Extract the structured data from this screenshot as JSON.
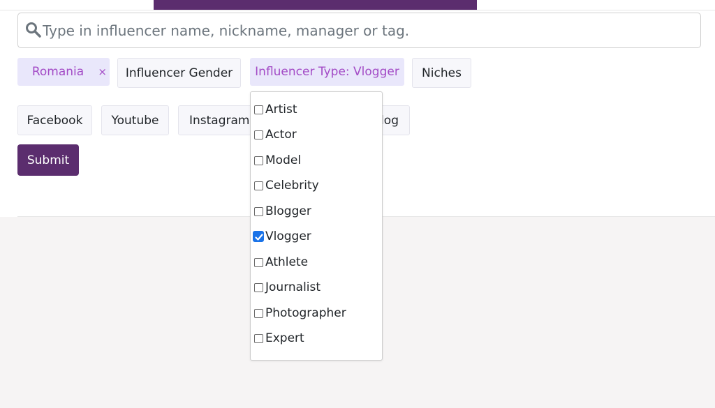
{
  "search": {
    "placeholder": "Type in influencer name, nickname, manager or tag.",
    "value": ""
  },
  "filters": {
    "country": {
      "label": "Romania",
      "remove_symbol": "×"
    },
    "gender": {
      "label": "Influencer Gender"
    },
    "type": {
      "label": "Influencer Type: Vlogger"
    },
    "niches": {
      "label": "Niches"
    }
  },
  "platforms": [
    {
      "label": "Facebook"
    },
    {
      "label": "Youtube"
    },
    {
      "label": "Instagram"
    },
    {
      "label": "log"
    }
  ],
  "submit_label": "Submit",
  "type_dropdown": {
    "options": [
      {
        "label": "Artist",
        "checked": false
      },
      {
        "label": "Actor",
        "checked": false
      },
      {
        "label": "Model",
        "checked": false
      },
      {
        "label": "Celebrity",
        "checked": false
      },
      {
        "label": "Blogger",
        "checked": false
      },
      {
        "label": "Vlogger",
        "checked": true
      },
      {
        "label": "Athlete",
        "checked": false
      },
      {
        "label": "Journalist",
        "checked": false
      },
      {
        "label": "Photographer",
        "checked": false
      },
      {
        "label": "Expert",
        "checked": false
      }
    ]
  },
  "colors": {
    "brand": "#5b2d6e",
    "active_chip_bg": "#e9e7fb",
    "active_chip_text": "#a34bc6",
    "checkbox_checked": "#1a73e8"
  }
}
